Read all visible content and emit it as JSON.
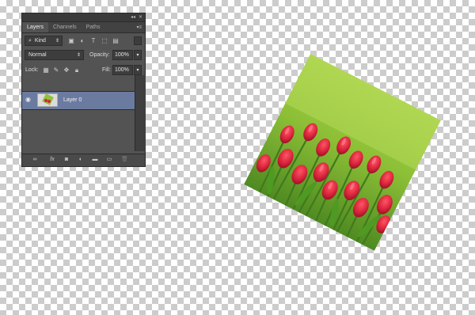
{
  "panel": {
    "tabs": [
      {
        "label": "Layers"
      },
      {
        "label": "Channels"
      },
      {
        "label": "Paths"
      }
    ],
    "filter": {
      "kind_label": "Kind"
    },
    "blend": {
      "mode_label": "Normal",
      "opacity_label": "Opacity:",
      "opacity_value": "100%"
    },
    "lock": {
      "label": "Lock:",
      "fill_label": "Fill:",
      "fill_value": "100%"
    },
    "layers": [
      {
        "name": "Layer 0"
      }
    ]
  },
  "colors": {
    "panel_bg": "#535353",
    "selected_layer": "#6b7ba0",
    "grass": "#8fc23a",
    "tulip_red": "#d8233a"
  },
  "image": {
    "subject": "red tulips on green grass",
    "rotation_deg": 27
  }
}
